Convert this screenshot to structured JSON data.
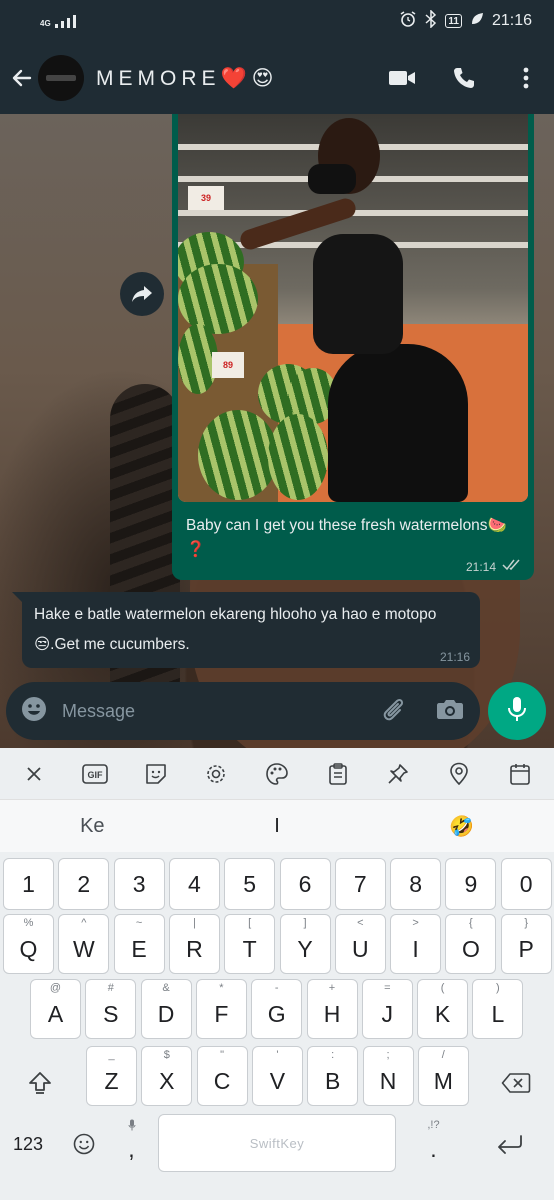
{
  "status_bar": {
    "network": "4G",
    "battery": "11",
    "time": "21:16"
  },
  "header": {
    "contact_name": "MEMORE❤️😍"
  },
  "messages": [
    {
      "direction": "outgoing",
      "type": "image",
      "caption": "Baby can I get you these fresh watermelons🍉❓",
      "time": "21:14",
      "status": "read-double-tick"
    },
    {
      "direction": "incoming",
      "type": "text",
      "text": "Hake e batle watermelon ekareng hlooho ya hao e motopo 😒.Get me cucumbers.",
      "time": "21:16"
    }
  ],
  "photo": {
    "price_tag_1": "39",
    "price_tag_2": "89"
  },
  "input": {
    "placeholder": "Message"
  },
  "keyboard": {
    "toolbar": [
      "close-icon",
      "gif-icon",
      "sticker-icon",
      "settings-icon",
      "theme-icon",
      "clipboard-icon",
      "pin-icon",
      "location-icon",
      "calendar-icon"
    ],
    "gif_label": "GIF",
    "suggestions": [
      "Ke",
      "I",
      "🤣"
    ],
    "number_row": [
      "1",
      "2",
      "3",
      "4",
      "5",
      "6",
      "7",
      "8",
      "9",
      "0"
    ],
    "row1": [
      {
        "alt": "%",
        "key": "Q"
      },
      {
        "alt": "^",
        "key": "W"
      },
      {
        "alt": "~",
        "key": "E"
      },
      {
        "alt": "|",
        "key": "R"
      },
      {
        "alt": "[",
        "key": "T"
      },
      {
        "alt": "]",
        "key": "Y"
      },
      {
        "alt": "<",
        "key": "U"
      },
      {
        "alt": ">",
        "key": "I"
      },
      {
        "alt": "{",
        "key": "O"
      },
      {
        "alt": "}",
        "key": "P"
      }
    ],
    "row2": [
      {
        "alt": "@",
        "key": "A"
      },
      {
        "alt": "#",
        "key": "S"
      },
      {
        "alt": "&",
        "key": "D"
      },
      {
        "alt": "*",
        "key": "F"
      },
      {
        "alt": "-",
        "key": "G"
      },
      {
        "alt": "+",
        "key": "H"
      },
      {
        "alt": "=",
        "key": "J"
      },
      {
        "alt": "(",
        "key": "K"
      },
      {
        "alt": ")",
        "key": "L"
      }
    ],
    "row3": [
      {
        "alt": "_",
        "key": "Z"
      },
      {
        "alt": "$",
        "key": "X"
      },
      {
        "alt": "\"",
        "key": "C"
      },
      {
        "alt": "'",
        "key": "V"
      },
      {
        "alt": ":",
        "key": "B"
      },
      {
        "alt": ";",
        "key": "N"
      },
      {
        "alt": "/",
        "key": "M"
      }
    ],
    "num_switch": "123",
    "comma": ",",
    "period": ".",
    "period_alt": ",!?",
    "space_label": "SwiftKey"
  },
  "colors": {
    "header_bg": "#1f2c34",
    "outgoing_bubble": "#005c4b",
    "incoming_bubble": "#202c33",
    "accent": "#00a884"
  }
}
